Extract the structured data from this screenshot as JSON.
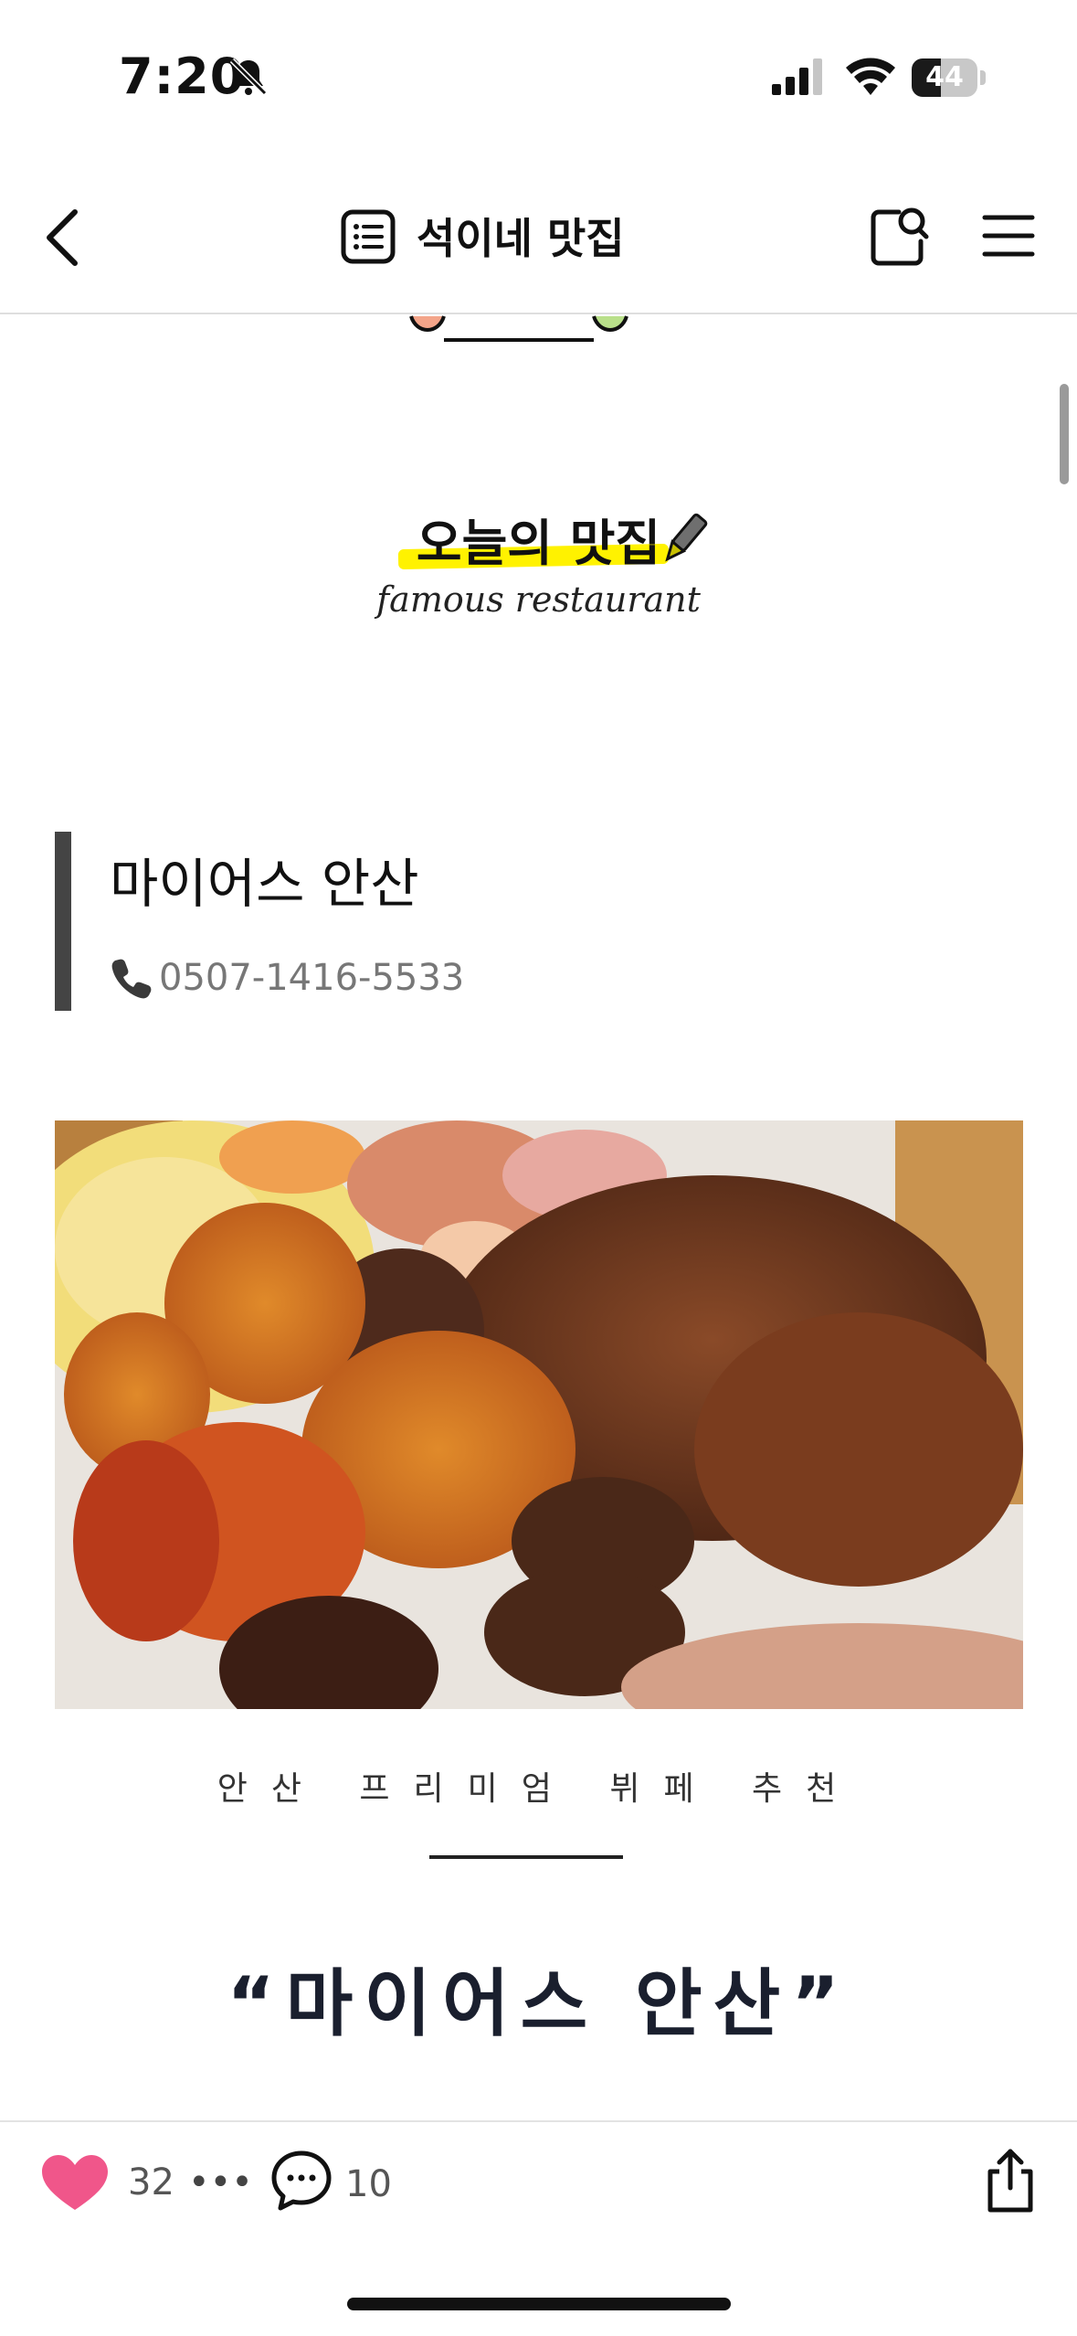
{
  "status_bar": {
    "time": "7:20",
    "battery": "44",
    "battery_level": 0.44
  },
  "nav": {
    "title": "석이네 맛집"
  },
  "header": {
    "today_title": "오늘의 맛집",
    "subtitle": "famous restaurant"
  },
  "place": {
    "name": "마이어스 안산",
    "phone": "0507-1416-5533"
  },
  "post": {
    "caption": "안산 프리미엄 뷔페 추천",
    "headline": "“마이어스 안산”"
  },
  "bottom_bar": {
    "likes": "32",
    "more": "•••",
    "comments": "10"
  },
  "colors": {
    "heart": "#f0568a",
    "highlight": "#fff200",
    "quote_bar": "#444444"
  },
  "icons": [
    "bell-slash-icon",
    "signal-icon",
    "wifi-icon",
    "battery-icon",
    "back-icon",
    "list-icon",
    "search-icon",
    "menu-icon",
    "pencil-icon",
    "phone-icon",
    "heart-icon",
    "comment-icon",
    "share-icon"
  ]
}
